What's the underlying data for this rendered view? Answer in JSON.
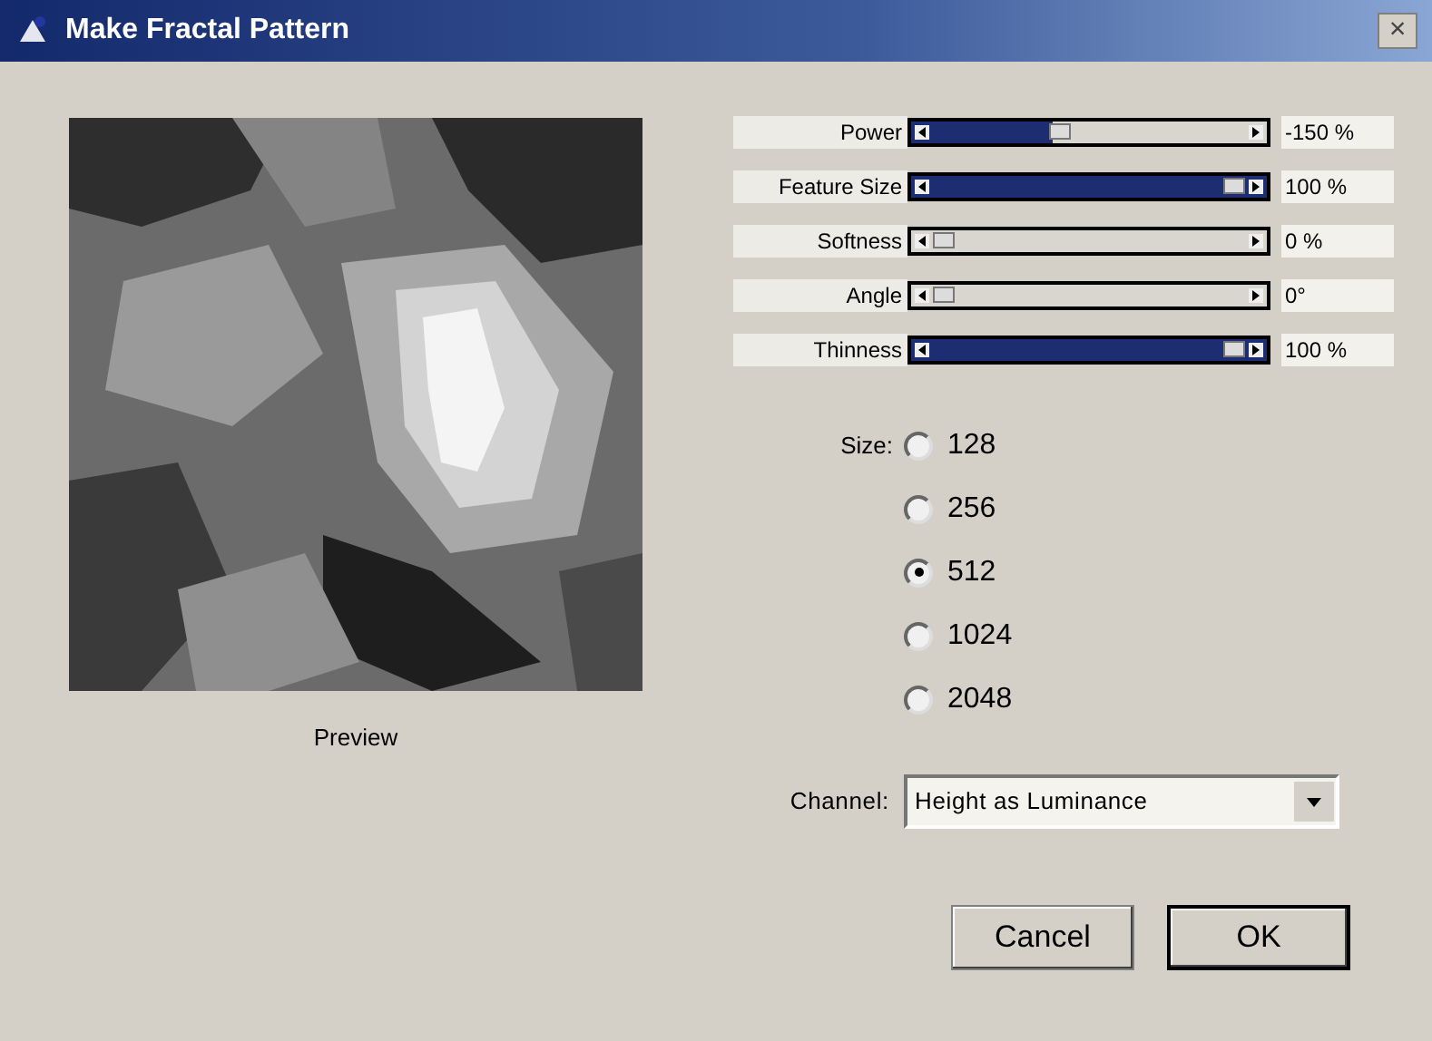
{
  "window": {
    "title": "Make Fractal Pattern",
    "close": "×"
  },
  "preview": {
    "caption": "Preview"
  },
  "sliders": [
    {
      "label": "Power",
      "level": 0.4,
      "reading": "-150 %"
    },
    {
      "label": "Feature Size",
      "level": 1,
      "reading": "100 %"
    },
    {
      "label": "Softness",
      "level": 0,
      "reading": "0 %"
    },
    {
      "label": "Angle",
      "level": 0,
      "reading": "0°"
    },
    {
      "label": "Thinness",
      "level": 1,
      "reading": "100 %"
    }
  ],
  "size": {
    "label": "Size:",
    "options": [
      {
        "label": "128",
        "selected": false
      },
      {
        "label": "256",
        "selected": false
      },
      {
        "label": "512",
        "selected": true
      },
      {
        "label": "1024",
        "selected": false
      },
      {
        "label": "2048",
        "selected": false
      }
    ]
  },
  "channel": {
    "label": "Channel:",
    "value": "Height as Luminance"
  },
  "buttons": [
    {
      "label": "Cancel",
      "default": false
    },
    {
      "label": "OK",
      "default": true
    }
  ]
}
